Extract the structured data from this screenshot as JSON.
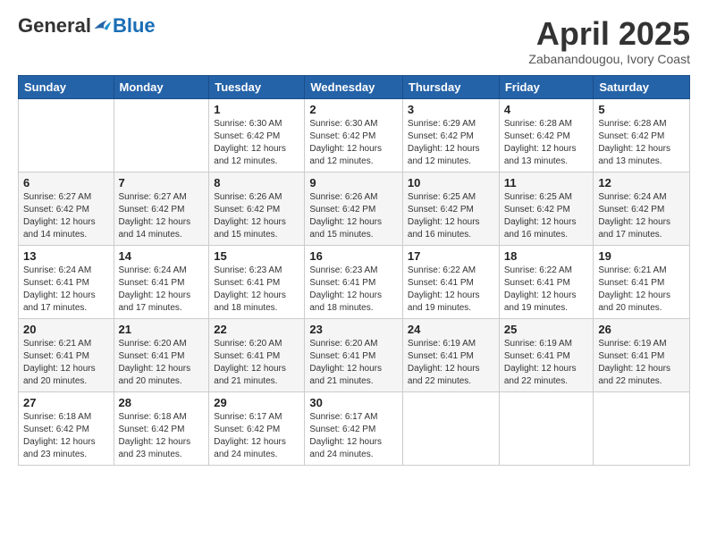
{
  "logo": {
    "general": "General",
    "blue": "Blue"
  },
  "header": {
    "title": "April 2025",
    "subtitle": "Zabanandougou, Ivory Coast"
  },
  "days_of_week": [
    "Sunday",
    "Monday",
    "Tuesday",
    "Wednesday",
    "Thursday",
    "Friday",
    "Saturday"
  ],
  "weeks": [
    [
      {
        "day": "",
        "info": ""
      },
      {
        "day": "",
        "info": ""
      },
      {
        "day": "1",
        "info": "Sunrise: 6:30 AM\nSunset: 6:42 PM\nDaylight: 12 hours and 12 minutes."
      },
      {
        "day": "2",
        "info": "Sunrise: 6:30 AM\nSunset: 6:42 PM\nDaylight: 12 hours and 12 minutes."
      },
      {
        "day": "3",
        "info": "Sunrise: 6:29 AM\nSunset: 6:42 PM\nDaylight: 12 hours and 12 minutes."
      },
      {
        "day": "4",
        "info": "Sunrise: 6:28 AM\nSunset: 6:42 PM\nDaylight: 12 hours and 13 minutes."
      },
      {
        "day": "5",
        "info": "Sunrise: 6:28 AM\nSunset: 6:42 PM\nDaylight: 12 hours and 13 minutes."
      }
    ],
    [
      {
        "day": "6",
        "info": "Sunrise: 6:27 AM\nSunset: 6:42 PM\nDaylight: 12 hours and 14 minutes."
      },
      {
        "day": "7",
        "info": "Sunrise: 6:27 AM\nSunset: 6:42 PM\nDaylight: 12 hours and 14 minutes."
      },
      {
        "day": "8",
        "info": "Sunrise: 6:26 AM\nSunset: 6:42 PM\nDaylight: 12 hours and 15 minutes."
      },
      {
        "day": "9",
        "info": "Sunrise: 6:26 AM\nSunset: 6:42 PM\nDaylight: 12 hours and 15 minutes."
      },
      {
        "day": "10",
        "info": "Sunrise: 6:25 AM\nSunset: 6:42 PM\nDaylight: 12 hours and 16 minutes."
      },
      {
        "day": "11",
        "info": "Sunrise: 6:25 AM\nSunset: 6:42 PM\nDaylight: 12 hours and 16 minutes."
      },
      {
        "day": "12",
        "info": "Sunrise: 6:24 AM\nSunset: 6:42 PM\nDaylight: 12 hours and 17 minutes."
      }
    ],
    [
      {
        "day": "13",
        "info": "Sunrise: 6:24 AM\nSunset: 6:41 PM\nDaylight: 12 hours and 17 minutes."
      },
      {
        "day": "14",
        "info": "Sunrise: 6:24 AM\nSunset: 6:41 PM\nDaylight: 12 hours and 17 minutes."
      },
      {
        "day": "15",
        "info": "Sunrise: 6:23 AM\nSunset: 6:41 PM\nDaylight: 12 hours and 18 minutes."
      },
      {
        "day": "16",
        "info": "Sunrise: 6:23 AM\nSunset: 6:41 PM\nDaylight: 12 hours and 18 minutes."
      },
      {
        "day": "17",
        "info": "Sunrise: 6:22 AM\nSunset: 6:41 PM\nDaylight: 12 hours and 19 minutes."
      },
      {
        "day": "18",
        "info": "Sunrise: 6:22 AM\nSunset: 6:41 PM\nDaylight: 12 hours and 19 minutes."
      },
      {
        "day": "19",
        "info": "Sunrise: 6:21 AM\nSunset: 6:41 PM\nDaylight: 12 hours and 20 minutes."
      }
    ],
    [
      {
        "day": "20",
        "info": "Sunrise: 6:21 AM\nSunset: 6:41 PM\nDaylight: 12 hours and 20 minutes."
      },
      {
        "day": "21",
        "info": "Sunrise: 6:20 AM\nSunset: 6:41 PM\nDaylight: 12 hours and 20 minutes."
      },
      {
        "day": "22",
        "info": "Sunrise: 6:20 AM\nSunset: 6:41 PM\nDaylight: 12 hours and 21 minutes."
      },
      {
        "day": "23",
        "info": "Sunrise: 6:20 AM\nSunset: 6:41 PM\nDaylight: 12 hours and 21 minutes."
      },
      {
        "day": "24",
        "info": "Sunrise: 6:19 AM\nSunset: 6:41 PM\nDaylight: 12 hours and 22 minutes."
      },
      {
        "day": "25",
        "info": "Sunrise: 6:19 AM\nSunset: 6:41 PM\nDaylight: 12 hours and 22 minutes."
      },
      {
        "day": "26",
        "info": "Sunrise: 6:19 AM\nSunset: 6:41 PM\nDaylight: 12 hours and 22 minutes."
      }
    ],
    [
      {
        "day": "27",
        "info": "Sunrise: 6:18 AM\nSunset: 6:42 PM\nDaylight: 12 hours and 23 minutes."
      },
      {
        "day": "28",
        "info": "Sunrise: 6:18 AM\nSunset: 6:42 PM\nDaylight: 12 hours and 23 minutes."
      },
      {
        "day": "29",
        "info": "Sunrise: 6:17 AM\nSunset: 6:42 PM\nDaylight: 12 hours and 24 minutes."
      },
      {
        "day": "30",
        "info": "Sunrise: 6:17 AM\nSunset: 6:42 PM\nDaylight: 12 hours and 24 minutes."
      },
      {
        "day": "",
        "info": ""
      },
      {
        "day": "",
        "info": ""
      },
      {
        "day": "",
        "info": ""
      }
    ]
  ]
}
